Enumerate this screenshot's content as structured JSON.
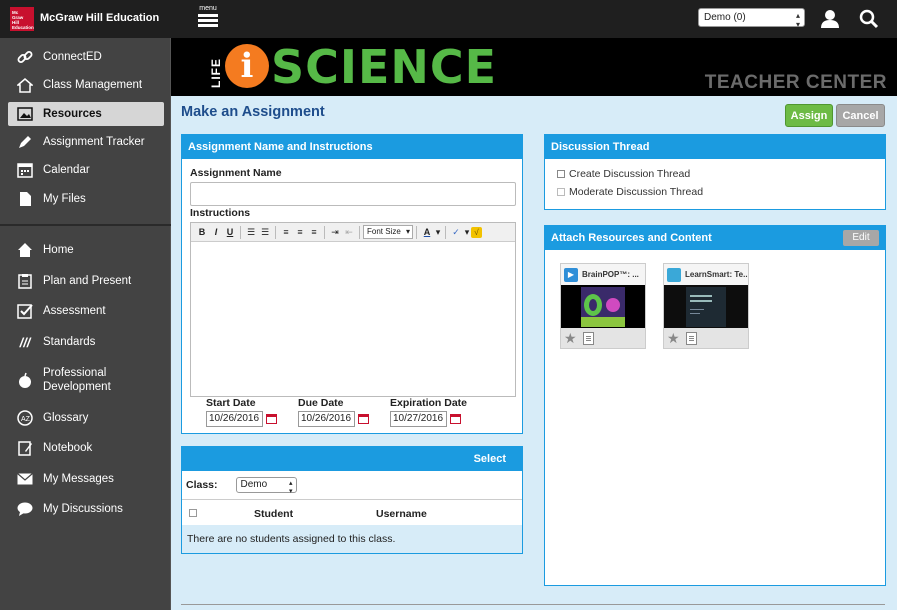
{
  "header": {
    "logo_lines": [
      "Mc",
      "Graw",
      "Hill",
      "Education"
    ],
    "brand": "McGraw Hill Education",
    "menu_label": "menu",
    "demo_select_value": "Demo (0)"
  },
  "sidebar": {
    "items": [
      {
        "label": "ConnectED",
        "icon": "link-icon"
      },
      {
        "label": "Class Management",
        "icon": "home-icon"
      },
      {
        "label": "Resources",
        "icon": "image-icon",
        "active": true
      },
      {
        "label": "Assignment Tracker",
        "icon": "pencil-icon"
      },
      {
        "label": "Calendar",
        "icon": "calendar-icon"
      },
      {
        "label": "My Files",
        "icon": "file-icon"
      },
      {
        "label": "Home",
        "icon": "house-icon"
      },
      {
        "label": "Plan and Present",
        "icon": "clipboard-icon"
      },
      {
        "label": "Assessment",
        "icon": "checkbox-icon"
      },
      {
        "label": "Standards",
        "icon": "slashes-icon"
      },
      {
        "label": "Professional",
        "label2": "Development",
        "icon": "apple-icon"
      },
      {
        "label": "Glossary",
        "icon": "glossary-icon"
      },
      {
        "label": "Notebook",
        "icon": "notebook-icon"
      },
      {
        "label": "My Messages",
        "icon": "envelope-icon"
      },
      {
        "label": "My Discussions",
        "icon": "speech-bubble-icon"
      }
    ]
  },
  "banner": {
    "life": "LIFE",
    "i": "i",
    "science": "SCIENCE",
    "teacher_center": "TEACHER CENTER"
  },
  "page": {
    "title": "Make an Assignment",
    "assign_label": "Assign",
    "cancel_label": "Cancel"
  },
  "assignment_panel": {
    "header": "Assignment Name and Instructions",
    "name_label": "Assignment Name",
    "name_value": "",
    "instructions_label": "Instructions",
    "toolbar": {
      "bold": "B",
      "italic": "I",
      "underline": "U",
      "font_size": "Font Size",
      "font_color": "A"
    },
    "start_date_label": "Start Date",
    "start_date_value": "10/26/2016",
    "due_date_label": "Due Date",
    "due_date_value": "10/26/2016",
    "expiration_date_label": "Expiration Date",
    "expiration_date_value": "10/27/2016"
  },
  "select_panel": {
    "header": "Select",
    "class_label": "Class:",
    "class_value": "Demo",
    "col_student": "Student",
    "col_username": "Username",
    "empty_message": "There are no students assigned to this class."
  },
  "discussion_panel": {
    "header": "Discussion Thread",
    "create_label": "Create Discussion Thread",
    "moderate_label": "Moderate Discussion Thread"
  },
  "attach_panel": {
    "header": "Attach Resources and Content",
    "edit_label": "Edit",
    "cards": [
      {
        "title": "BrainPOP™: ...",
        "icon_color": "#2f8fd8"
      },
      {
        "title": "LearnSmart: Te...",
        "icon_color": "#3aa8d8"
      }
    ]
  },
  "colors": {
    "accent_blue": "#1b9be0",
    "title_blue": "#1e4d8c",
    "assign_green": "#6dbb45",
    "science_green": "#56b947",
    "i_orange": "#f47b20",
    "sidebar_bg": "#434343",
    "content_bg": "#d7ecf8"
  }
}
